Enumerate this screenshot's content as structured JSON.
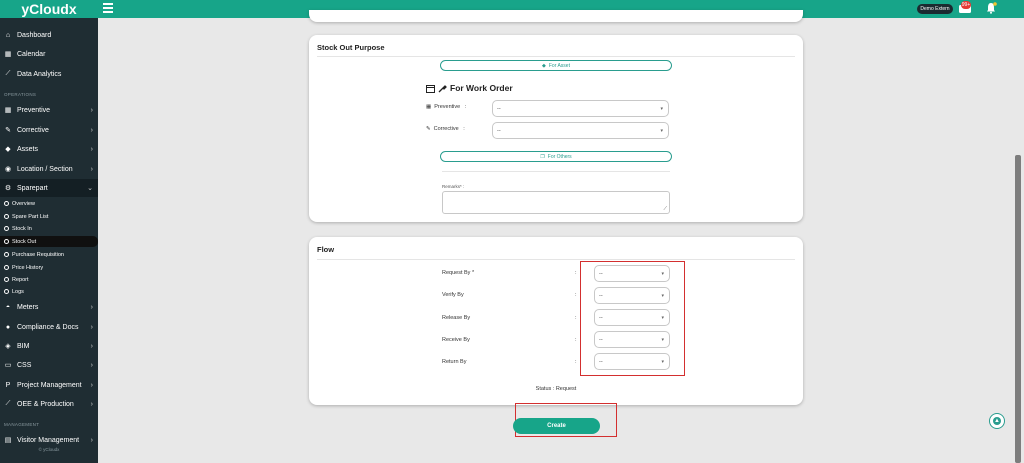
{
  "app": {
    "brand": "yCloudx",
    "user": "Demo Extern",
    "notifications": "99+"
  },
  "sidebar": {
    "items": [
      {
        "label": "Dashboard",
        "icon": "home-icon",
        "glyph": "⌂",
        "chevron": ""
      },
      {
        "label": "Calendar",
        "icon": "calendar-icon",
        "glyph": "▦",
        "chevron": ""
      },
      {
        "label": "Data Analytics",
        "icon": "chart-icon",
        "glyph": "⟋",
        "chevron": ""
      },
      {
        "label": "Preventive",
        "icon": "calendar-icon",
        "glyph": "▦",
        "chevron": "›"
      },
      {
        "label": "Corrective",
        "icon": "wrench-icon",
        "glyph": "✎",
        "chevron": "›"
      },
      {
        "label": "Assets",
        "icon": "tag-icon",
        "glyph": "◆",
        "chevron": "›"
      },
      {
        "label": "Location / Section",
        "icon": "location-icon",
        "glyph": "◉",
        "chevron": "›"
      },
      {
        "label": "Sparepart",
        "icon": "sparepart-icon",
        "glyph": "⚙",
        "chevron": "⌄"
      },
      {
        "label": "Meters",
        "icon": "meter-icon",
        "glyph": "◓",
        "chevron": "›"
      },
      {
        "label": "Compliance & Docs",
        "icon": "compliance-icon",
        "glyph": "●",
        "chevron": "›"
      },
      {
        "label": "BIM",
        "icon": "bim-icon",
        "glyph": "◈",
        "chevron": "›"
      },
      {
        "label": "CSS",
        "icon": "monitor-icon",
        "glyph": "▭",
        "chevron": "›"
      },
      {
        "label": "Project Management",
        "icon": "project-icon",
        "glyph": "P",
        "chevron": "›"
      },
      {
        "label": "OEE & Production",
        "icon": "chart-icon",
        "glyph": "⟋",
        "chevron": "›"
      },
      {
        "label": "Visitor Management",
        "icon": "id-card-icon",
        "glyph": "▤",
        "chevron": "›"
      }
    ],
    "sections": {
      "operations": "OPERATIONS",
      "management": "MANAGEMENT"
    },
    "subitems": [
      "Overview",
      "Spare Part List",
      "Stock In",
      "Stock Out",
      "Purchase Requisition",
      "Price History",
      "Report",
      "Logs"
    ],
    "footer": "© yCloudx"
  },
  "purpose": {
    "title": "Stock Out Purpose",
    "for_asset": "For Asset",
    "work_order_title": "For Work Order",
    "preventive_label": "Preventive",
    "corrective_label": "Corrective",
    "select_placeholder": "--",
    "for_others": "For Others",
    "remarks_label": "Remarks* :"
  },
  "flow": {
    "title": "Flow",
    "rows": [
      {
        "label": "Request By *",
        "value": "--"
      },
      {
        "label": "Verify By",
        "value": "--"
      },
      {
        "label": "Release By",
        "value": "--"
      },
      {
        "label": "Receive By",
        "value": "--"
      },
      {
        "label": "Return By",
        "value": "--"
      }
    ],
    "colon": ":",
    "status": "Status : Request"
  },
  "actions": {
    "create": "Create"
  },
  "colors": {
    "brand": "#17a589",
    "sidebar": "#1f2d33",
    "highlight": "#d32f2f"
  }
}
